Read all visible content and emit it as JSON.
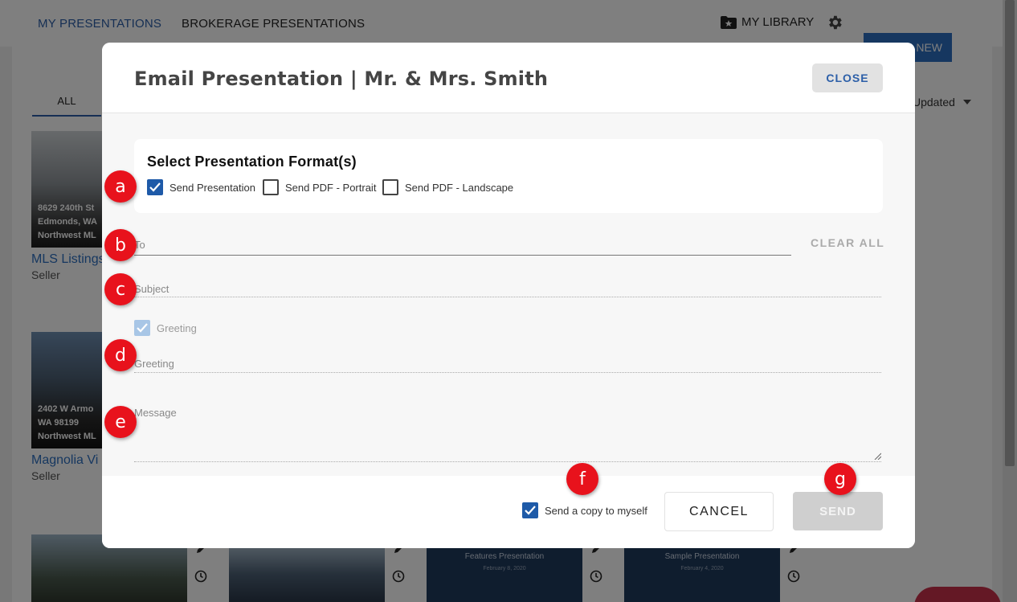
{
  "nav": {
    "tabs": [
      {
        "label": "MY PRESENTATIONS",
        "active": true
      },
      {
        "label": "BROKERAGE PRESENTATIONS",
        "active": false
      }
    ],
    "library_label": "MY LIBRARY",
    "new_label": "NEW"
  },
  "content": {
    "filter_tab": "ALL",
    "sort_label": "Updated",
    "cards": [
      {
        "caption_lines": [
          "8629 240th St",
          "Edmonds, WA",
          "Northwest ML"
        ],
        "title": "MLS Listings",
        "subtitle": "Seller"
      },
      {
        "caption_lines": [
          "2402 W Armo",
          "WA 98199",
          "Northwest ML"
        ],
        "title": "Magnolia Vi",
        "subtitle": "Seller"
      }
    ],
    "thumbnails": [
      {
        "title": "",
        "date": ""
      },
      {
        "title": "",
        "date": ""
      },
      {
        "title": "Features Presentation",
        "date": "February 8, 2020"
      },
      {
        "title": "Sample Presentation",
        "date": "February 4, 2020"
      }
    ]
  },
  "modal": {
    "title": "Email Presentation | Mr. & Mrs. Smith",
    "close_label": "CLOSE",
    "format_title": "Select Presentation Format(s)",
    "formats": [
      {
        "label": "Send Presentation",
        "checked": true
      },
      {
        "label": "Send PDF - Portrait",
        "checked": false
      },
      {
        "label": "Send PDF - Landscape",
        "checked": false
      }
    ],
    "to_placeholder": "To",
    "clear_all_label": "CLEAR ALL",
    "subject_placeholder": "Subject",
    "greeting_toggle_label": "Greeting",
    "greeting_placeholder": "Greeting",
    "message_placeholder": "Message",
    "copy_label": "Send a copy to myself",
    "cancel_label": "CANCEL",
    "send_label": "SEND"
  },
  "callouts": [
    "a",
    "b",
    "c",
    "d",
    "e",
    "f",
    "g"
  ],
  "colors": {
    "accent": "#1e5aa8",
    "badge": "#e8121c",
    "link": "#2c6fc0"
  }
}
